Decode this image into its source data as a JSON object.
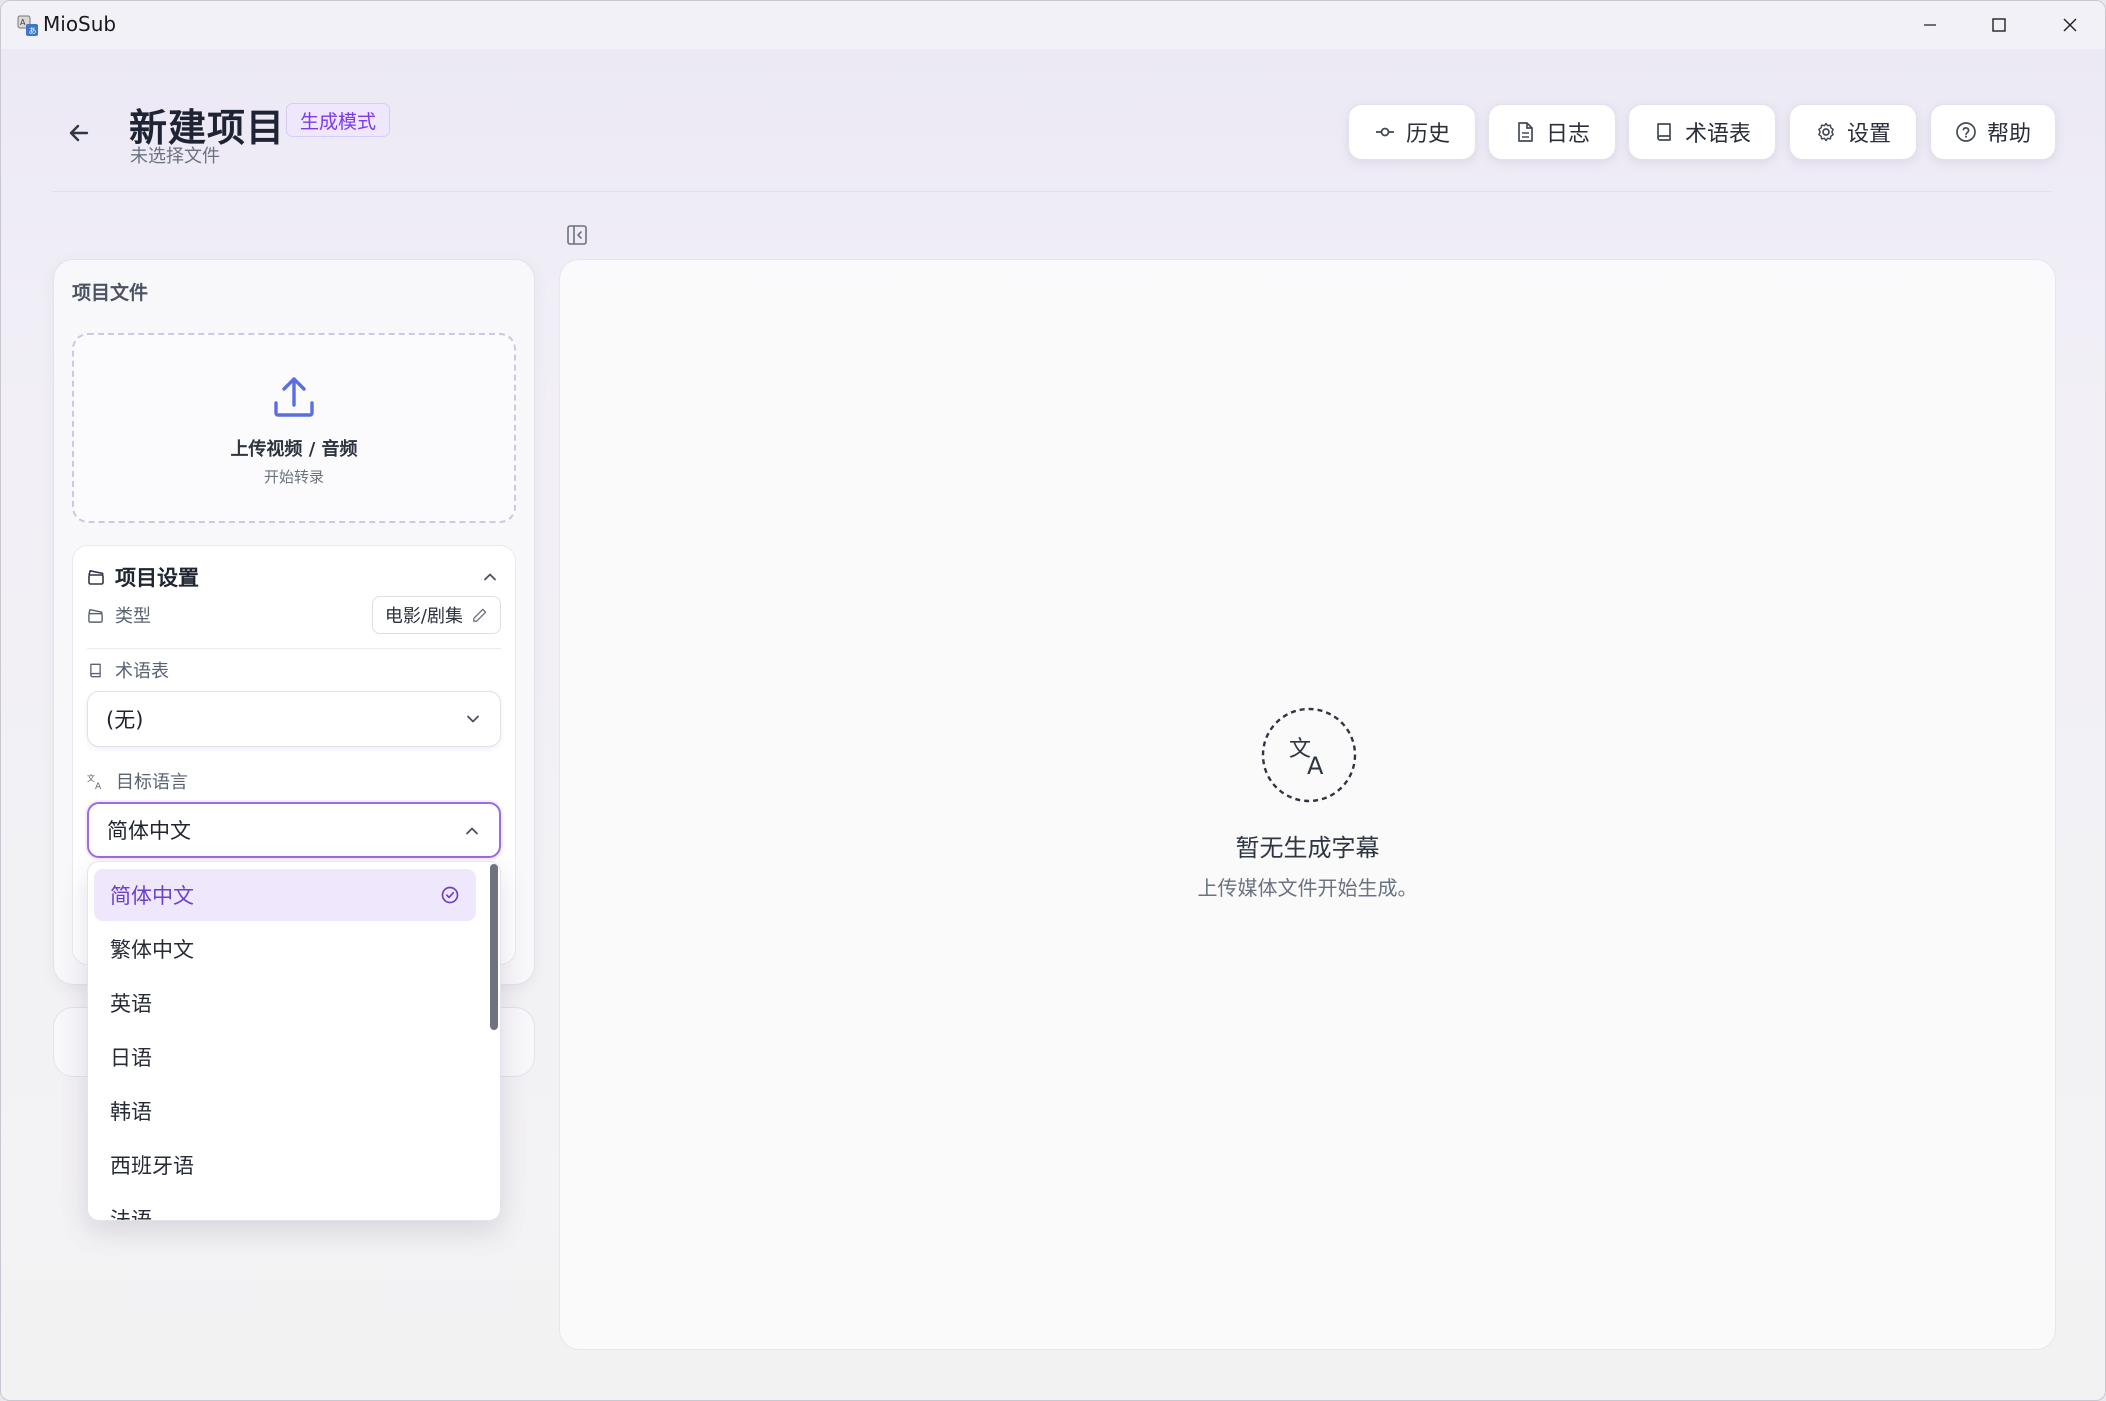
{
  "window": {
    "title": "MioSub",
    "controls": [
      "minimize-icon",
      "maximize-icon",
      "close-icon"
    ]
  },
  "header": {
    "back_icon": "arrow-left-icon",
    "title": "新建项目",
    "badge": "生成模式",
    "subtitle": "未选择文件",
    "buttons": [
      {
        "label": "历史",
        "icon": "history-icon"
      },
      {
        "label": "日志",
        "icon": "document-icon"
      },
      {
        "label": "术语表",
        "icon": "book-icon"
      },
      {
        "label": "设置",
        "icon": "gear-icon"
      },
      {
        "label": "帮助",
        "icon": "help-icon"
      }
    ]
  },
  "sidebar": {
    "section_title": "项目文件",
    "upload": {
      "title": "上传视频 / 音频",
      "subtitle": "开始转录",
      "icon": "upload-icon"
    },
    "settings": {
      "title": "项目设置",
      "type_label": "类型",
      "type_value": "电影/剧集",
      "glossary_label": "术语表",
      "glossary_value": "(无)",
      "target_lang_label": "目标语言",
      "target_lang_value": "简体中文"
    }
  },
  "dropdown": {
    "options": [
      "简体中文",
      "繁体中文",
      "英语",
      "日语",
      "韩语",
      "西班牙语",
      "法语"
    ],
    "selected": "简体中文"
  },
  "main": {
    "empty_icon": "translate-icon",
    "empty_title": "暂无生成字幕",
    "empty_subtitle": "上传媒体文件开始生成。"
  },
  "colors": {
    "accent": "#7c3aed",
    "badge_bg": "#efe8fd",
    "selected_bg": "#efe7fb"
  }
}
